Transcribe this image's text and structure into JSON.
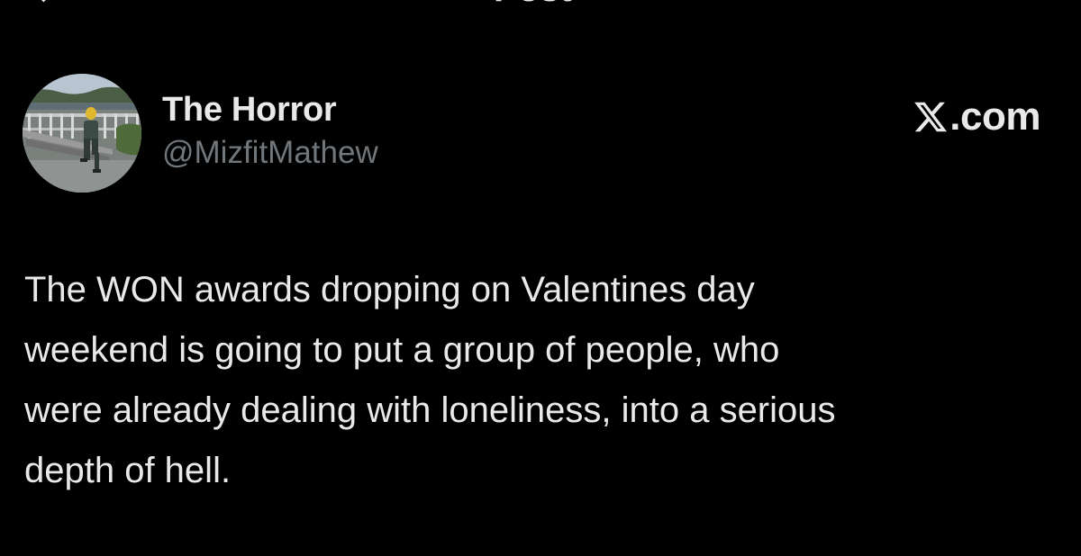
{
  "header": {
    "title": "Post",
    "back_icon": "back-arrow-icon"
  },
  "author": {
    "display_name": "The Horror",
    "handle": "@MizfitMathew",
    "avatar": "profile-photo"
  },
  "brand": {
    "text": ".com",
    "logo_icon": "x-logo-icon"
  },
  "post": {
    "lines": [
      "The WON awards dropping on Valentines day",
      "weekend is going to put a group of people, who",
      "were already dealing with loneliness, into a serious",
      "depth of hell."
    ]
  },
  "colors": {
    "background": "#000000",
    "primary_text": "#e7e9ea",
    "secondary_text": "#71767b"
  }
}
